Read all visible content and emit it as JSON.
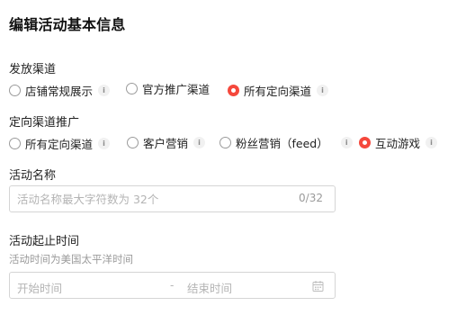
{
  "page": {
    "title": "编辑活动基本信息"
  },
  "distribution": {
    "label": "发放渠道",
    "info_glyph": "i",
    "options": [
      {
        "label": "店铺常规展示",
        "checked": false
      },
      {
        "label": "官方推广渠道",
        "checked": false
      },
      {
        "label": "所有定向渠道",
        "checked": true
      }
    ]
  },
  "targeted": {
    "label": "定向渠道推广",
    "info_glyph": "i",
    "options": [
      {
        "label": "所有定向渠道",
        "checked": false
      },
      {
        "label": "客户营销",
        "checked": false
      },
      {
        "label": "粉丝营销（feed）",
        "checked": false
      },
      {
        "label": "互动游戏",
        "checked": true
      }
    ]
  },
  "activity_name": {
    "label": "活动名称",
    "placeholder": "活动名称最大字符数为 32个",
    "value": "",
    "counter": "0/32"
  },
  "activity_time": {
    "label": "活动起止时间",
    "hint": "活动时间为美国太平洋时间",
    "start_placeholder": "开始时间",
    "separator": "-",
    "end_placeholder": "结束时间",
    "calendar_icon": "calendar-icon"
  },
  "colors": {
    "accent": "#f5483c",
    "border": "#d5d5d5",
    "placeholder": "#b4b4b4"
  }
}
